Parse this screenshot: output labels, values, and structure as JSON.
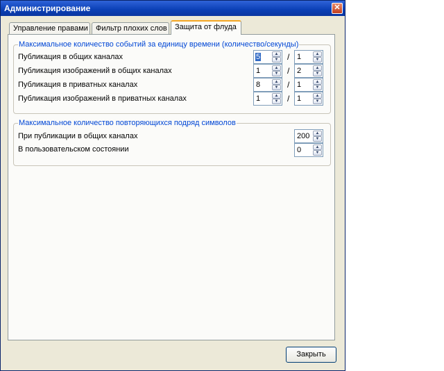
{
  "window": {
    "title": "Администрирование",
    "close_glyph": "✕"
  },
  "tabs": [
    {
      "label": "Управление правами"
    },
    {
      "label": "Фильтр плохих слов"
    },
    {
      "label": "Защита от флуда"
    }
  ],
  "events_group": {
    "title": "Максимальное количество событий за единицу времени (количество/секунды)",
    "separator": "/",
    "rows": [
      {
        "label": "Публикация в общих каналах",
        "count": "5",
        "seconds": "1"
      },
      {
        "label": "Публикация изображений в общих каналах",
        "count": "1",
        "seconds": "2"
      },
      {
        "label": "Публикация в приватных каналах",
        "count": "8",
        "seconds": "1"
      },
      {
        "label": "Публикация изображений в приватных каналах",
        "count": "1",
        "seconds": "1"
      }
    ]
  },
  "repeat_group": {
    "title": "Максимальное количество повторяющихся подряд символов",
    "rows": [
      {
        "label": "При публикации в общих каналах",
        "value": "200"
      },
      {
        "label": "В пользовательском состоянии",
        "value": "0"
      }
    ]
  },
  "spin_arrows": {
    "up": "▲",
    "down": "▼"
  },
  "footer": {
    "close_label": "Закрыть"
  }
}
